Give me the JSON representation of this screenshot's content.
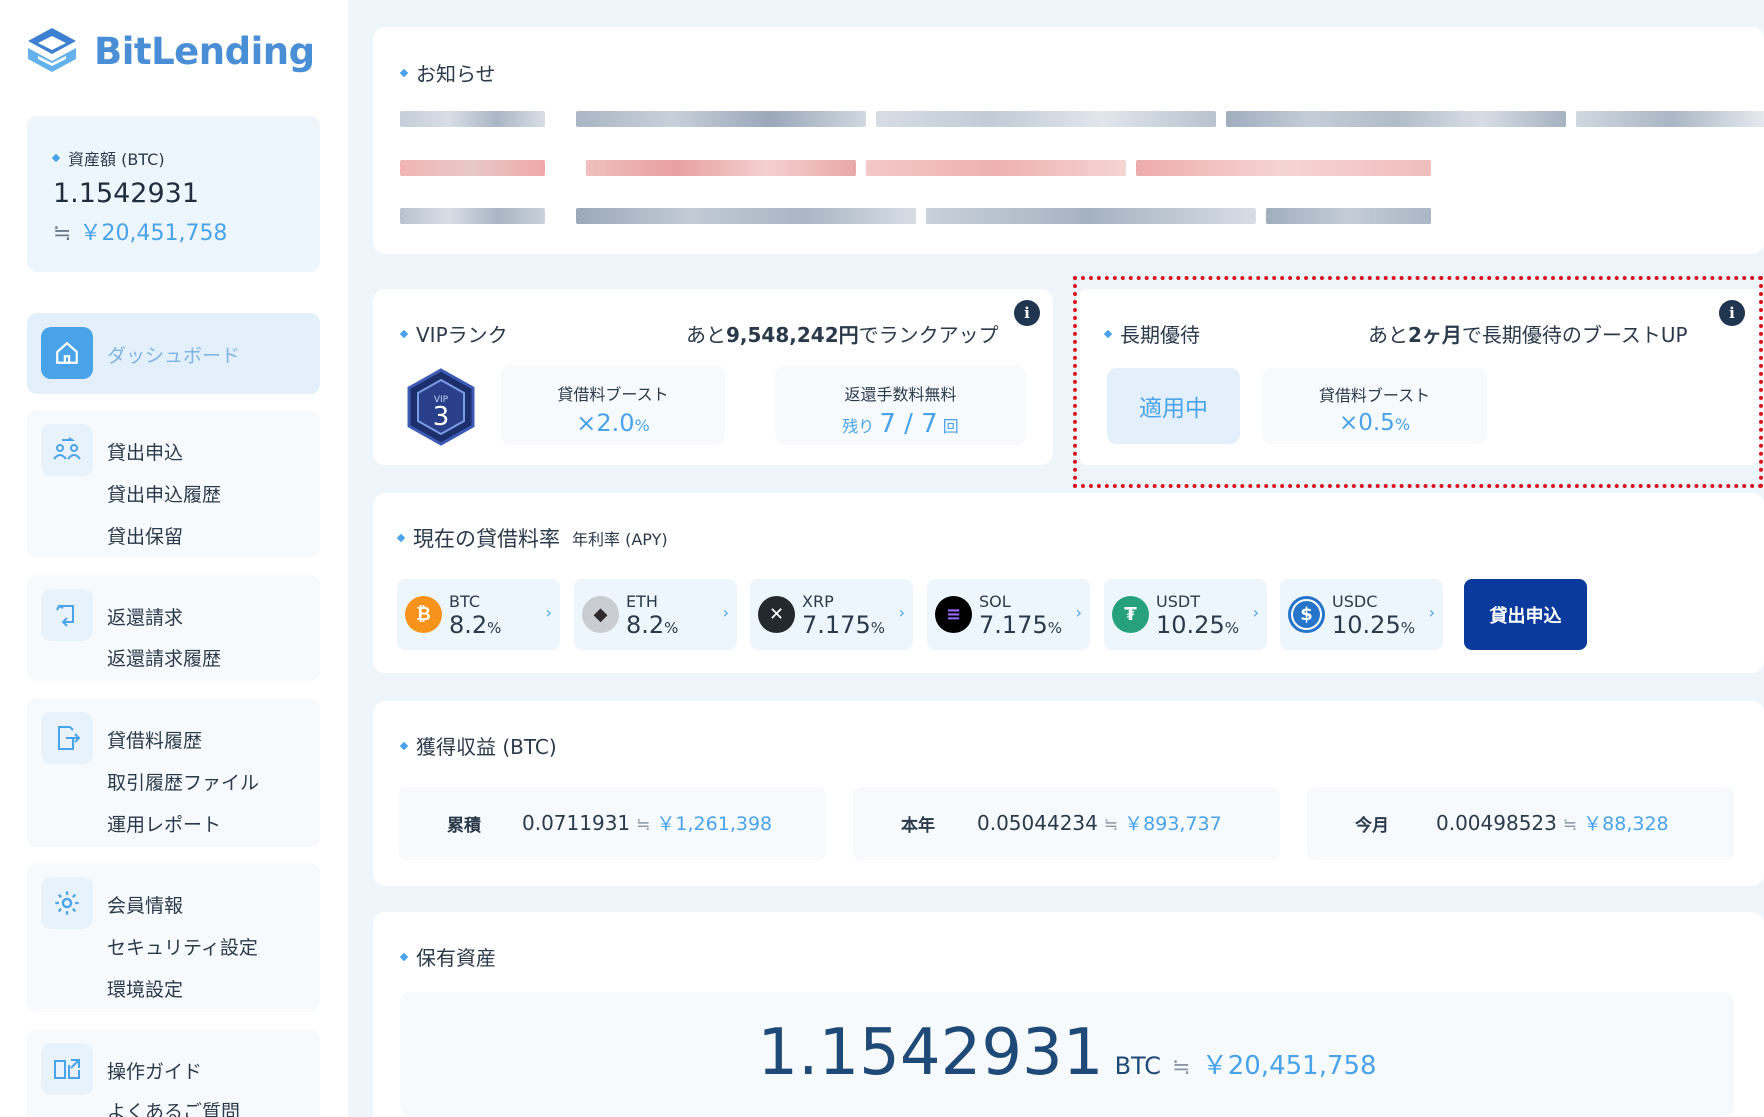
{
  "brand": {
    "name": "BitLending"
  },
  "asset_card": {
    "label": "資産額 (BTC)",
    "value": "1.1542931",
    "approx": "≒",
    "yen": "￥20,451,758"
  },
  "nav": {
    "dashboard": "ダッシュボード",
    "lending": [
      "貸出申込",
      "貸出申込履歴",
      "貸出保留"
    ],
    "returns": [
      "返還請求",
      "返還請求履歴"
    ],
    "history": [
      "貸借料履歴",
      "取引履歴ファイル",
      "運用レポート"
    ],
    "member": [
      "会員情報",
      "セキュリティ設定",
      "環境設定"
    ],
    "guide": [
      "操作ガイド",
      "よくあるご質問"
    ]
  },
  "notice": {
    "title": "お知らせ"
  },
  "vip": {
    "title": "VIPランク",
    "badge_label": "VIP",
    "rank": "3",
    "rankup_pre": "あと",
    "rankup_amount": "9,548,242円",
    "rankup_post": "でランクアップ",
    "boost_label": "貸借料ブースト",
    "boost_value": "×2.0",
    "boost_unit": "%",
    "fee_label": "返還手数料無料",
    "fee_pre": "残り",
    "fee_value": "7 / 7",
    "fee_unit": "回"
  },
  "long_term": {
    "title": "長期優待",
    "msg_pre": "あと",
    "msg_amount": "2ヶ月",
    "msg_post": "で長期優待のブーストUP",
    "status": "適用中",
    "boost_label": "貸借料ブースト",
    "boost_value": "×0.5",
    "boost_unit": "%"
  },
  "info_icon": "i",
  "rates": {
    "title": "現在の貸借料率",
    "subtitle": "年利率 (APY)",
    "apply_button": "貸出申込",
    "items": [
      {
        "name": "BTC",
        "value": "8.2",
        "unit": "%",
        "color": "#f7931a",
        "glyph": "₿"
      },
      {
        "name": "ETH",
        "value": "8.2",
        "unit": "%",
        "color": "#c9ccd1",
        "glyph": "◆"
      },
      {
        "name": "XRP",
        "value": "7.175",
        "unit": "%",
        "color": "#23292f",
        "glyph": "✕"
      },
      {
        "name": "SOL",
        "value": "7.175",
        "unit": "%",
        "color": "#000000",
        "glyph": "≡"
      },
      {
        "name": "USDT",
        "value": "10.25",
        "unit": "%",
        "color": "#26a17b",
        "glyph": "₮"
      },
      {
        "name": "USDC",
        "value": "10.25",
        "unit": "%",
        "color": "#2775ca",
        "glyph": "$"
      }
    ]
  },
  "earnings": {
    "title": "獲得収益 (BTC)",
    "approx": "≒",
    "items": [
      {
        "label": "累積",
        "value": "0.0711931",
        "yen": "￥1,261,398"
      },
      {
        "label": "本年",
        "value": "0.05044234",
        "yen": "￥893,737"
      },
      {
        "label": "今月",
        "value": "0.00498523",
        "yen": "￥88,328"
      }
    ]
  },
  "holdings": {
    "title": "保有資産",
    "value": "1.1542931",
    "unit": "BTC",
    "approx": "≒",
    "yen": "￥20,451,758"
  }
}
